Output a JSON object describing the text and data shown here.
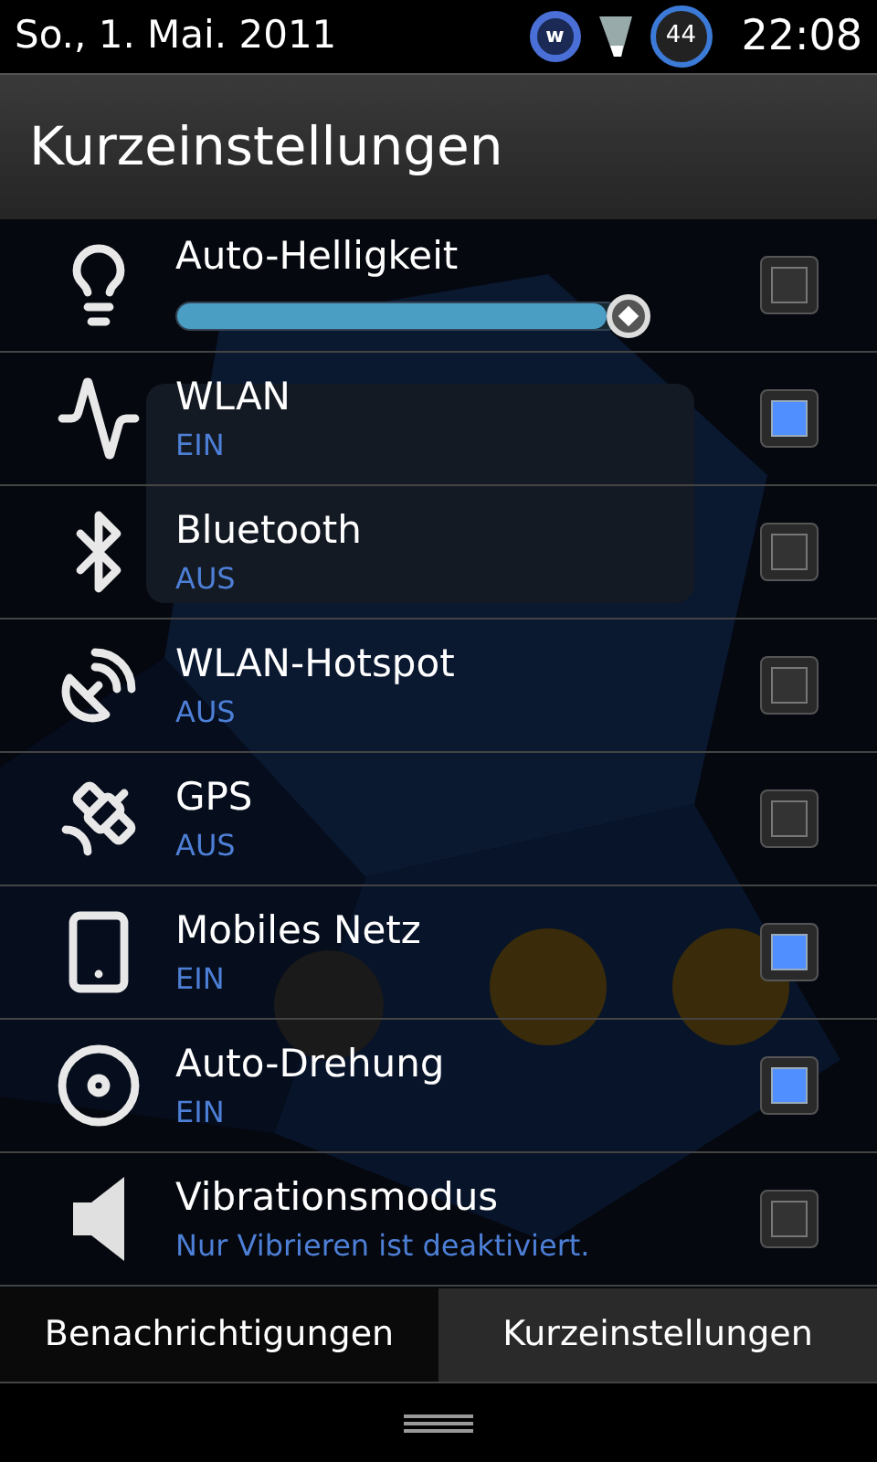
{
  "status_bar": {
    "date": "So., 1. Mai. 2011",
    "app_badge": "w",
    "battery": "44",
    "time": "22:08"
  },
  "header": {
    "title": "Kurzeinstellungen"
  },
  "settings": [
    {
      "kind": "slider",
      "label": "Auto-Helligkeit",
      "level": 0.97,
      "checked": false
    },
    {
      "kind": "toggle",
      "label": "WLAN",
      "status": "EIN",
      "checked": true
    },
    {
      "kind": "toggle",
      "label": "Bluetooth",
      "status": "AUS",
      "checked": false
    },
    {
      "kind": "toggle",
      "label": "WLAN-Hotspot",
      "status": "AUS",
      "checked": false
    },
    {
      "kind": "toggle",
      "label": "GPS",
      "status": "AUS",
      "checked": false
    },
    {
      "kind": "toggle",
      "label": "Mobiles Netz",
      "status": "EIN",
      "checked": true
    },
    {
      "kind": "toggle",
      "label": "Auto-Drehung",
      "status": "EIN",
      "checked": true
    },
    {
      "kind": "toggle",
      "label": "Vibrationsmodus",
      "status": "Nur Vibrieren ist deaktiviert.",
      "checked": false
    }
  ],
  "tabs": [
    {
      "label": "Benachrichtigungen",
      "selected": false
    },
    {
      "label": "Kurzeinstellungen",
      "selected": true
    }
  ]
}
